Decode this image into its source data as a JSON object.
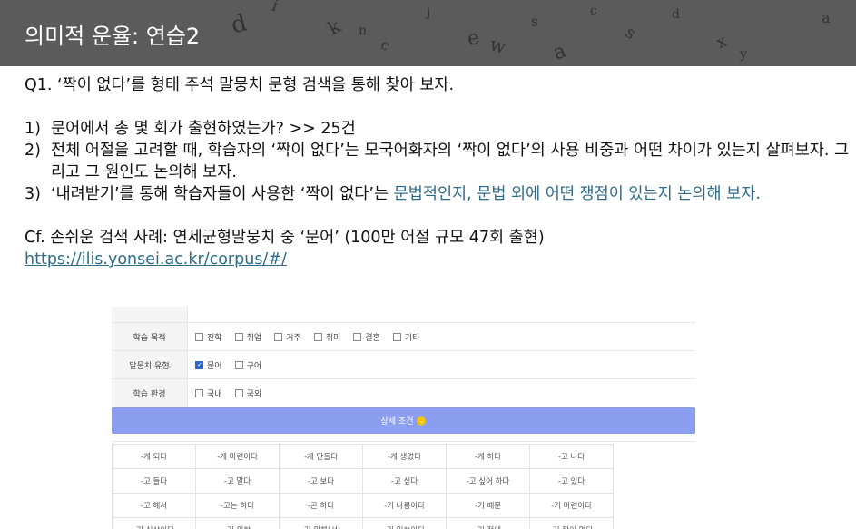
{
  "slide": {
    "title": "의미적 운율: 연습2"
  },
  "content": {
    "q1": "Q1. ‘짝이 없다’를 형태 주석 말뭉치 문형 검색을 통해 찾아 보자.",
    "items": [
      {
        "num": "1)",
        "text": "문어에서 총 몇 회가 출현하였는가?  >> 25건"
      },
      {
        "num": "2)",
        "text": "전체 어절을 고려할 때, 학습자의 ‘짝이 없다’는 모국어화자의 ‘짝이 없다’의 사용 비중과 어떤 차이가 있는지 살펴보자. 그리고 그 원인도 논의해 보자."
      },
      {
        "num": "3)",
        "text_a": "‘내려받기’를 통해 학습자들이 사용한 ‘짝이 없다’는 ",
        "text_b": "문법적인지, 문법 외에 어떤 쟁점이 있는지 논의해 보자."
      }
    ],
    "cf": "Cf. 손쉬운 검색 사례: 연세균형말뭉치 중 ‘문어’ (100만 어절 규모 47회 출현)",
    "link": "https://ilis.yonsei.ac.kr/corpus/#/"
  },
  "screenshot": {
    "rows": [
      {
        "label": "학습 목적",
        "options": [
          {
            "label": "진학",
            "checked": false
          },
          {
            "label": "취업",
            "checked": false
          },
          {
            "label": "거주",
            "checked": false
          },
          {
            "label": "취미",
            "checked": false
          },
          {
            "label": "결혼",
            "checked": false
          },
          {
            "label": "기타",
            "checked": false
          }
        ]
      },
      {
        "label": "말뭉치 유형",
        "options": [
          {
            "label": "문어",
            "checked": true
          },
          {
            "label": "구어",
            "checked": false
          }
        ]
      },
      {
        "label": "학습 환경",
        "options": [
          {
            "label": "국내",
            "checked": false
          },
          {
            "label": "국외",
            "checked": false
          }
        ]
      }
    ],
    "detail_button": "상세 조건",
    "grid": [
      [
        "-게 되다",
        "-게 마련이다",
        "-게 만들다",
        "-게 생겼다",
        "-게 하다",
        "-고 나다"
      ],
      [
        "-고 들다",
        "-고 말다",
        "-고 보다",
        "-고 싶다",
        "-고 싶어 하다",
        "-고 있다"
      ],
      [
        "-고 해서",
        "-고는 하다",
        "-곤 하다",
        "-기 나름이다",
        "-기 때문",
        "-기 마련이다"
      ],
      [
        "-기 십상이다",
        "-기 위한",
        "-기 위해(서)",
        "-기 일쑤이다",
        "-기 전에",
        "-기 짝이 없다"
      ]
    ]
  }
}
